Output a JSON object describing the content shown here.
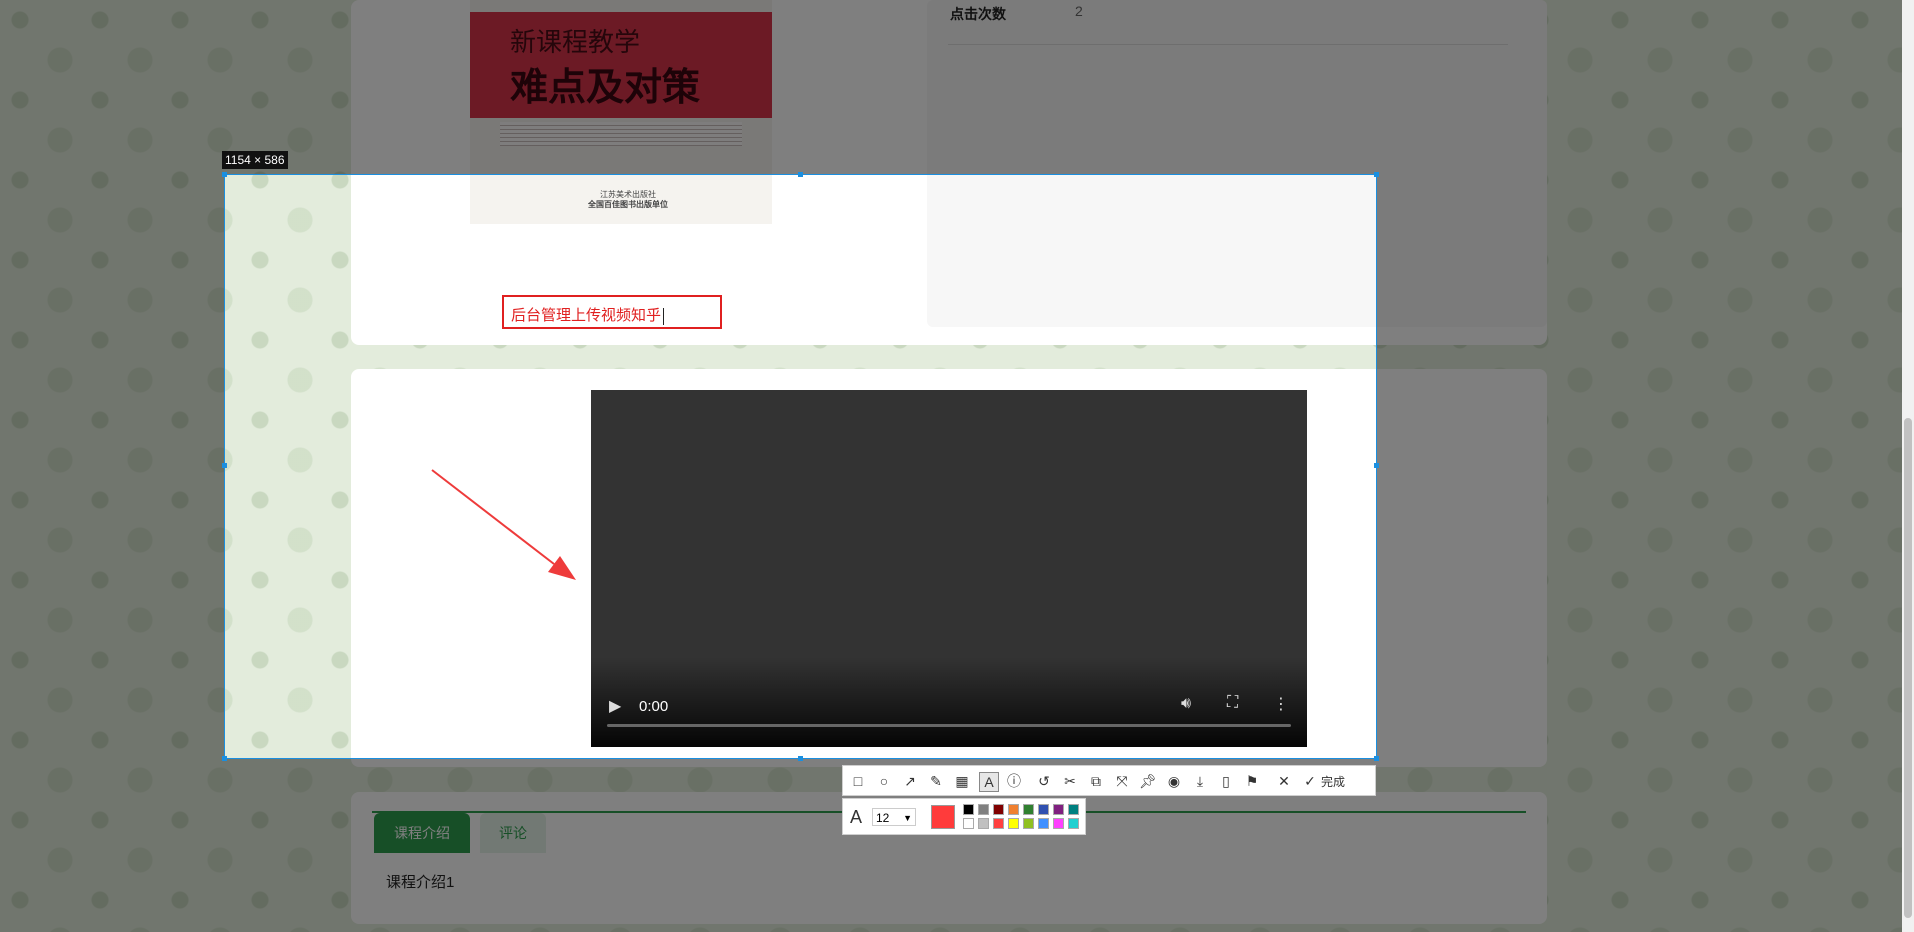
{
  "course": {
    "cover": {
      "title_line1": "新课程教学",
      "title_line2": "难点及对策",
      "publisher": "江苏美术出版社",
      "publisher_note": "全国百佳图书出版单位"
    },
    "stat_label": "点击次数",
    "stat_value": "2"
  },
  "annotation": {
    "text": "后台管理上传视频知乎",
    "color": "#e02020"
  },
  "video": {
    "time": "0:00",
    "play_icon": "play-icon",
    "volume_icon": "volume-icon",
    "fullscreen_icon": "fullscreen-icon",
    "more_icon": "more-vertical-icon"
  },
  "screenshot_tool": {
    "selection_size": "1154 × 586",
    "done_label": "完成",
    "font_size": "12",
    "tools": [
      "rectangle-icon",
      "ellipse-icon",
      "arrow-icon",
      "pencil-icon",
      "mosaic-icon",
      "text-icon",
      "serial-number-icon",
      "undo-icon",
      "ocr-icon",
      "translate-icon",
      "long-screenshot-icon",
      "pin-icon",
      "record-icon",
      "download-icon",
      "phone-icon",
      "bookmark-icon",
      "cancel-icon",
      "check-icon"
    ],
    "current_color": "#ff3b3b",
    "palette_top": [
      "#000000",
      "#808080",
      "#800000",
      "#f08030",
      "#308030",
      "#3050b0",
      "#802080",
      "#008080"
    ],
    "palette_bottom": [
      "#ffffff",
      "#c0c0c0",
      "#ff4040",
      "#ffff00",
      "#90c020",
      "#4090ff",
      "#ff40ff",
      "#20d0d0"
    ]
  },
  "tabs": {
    "intro": "课程介绍",
    "comments": "评论",
    "intro_content": "课程介绍1",
    "accent": "#2e9e4f"
  }
}
